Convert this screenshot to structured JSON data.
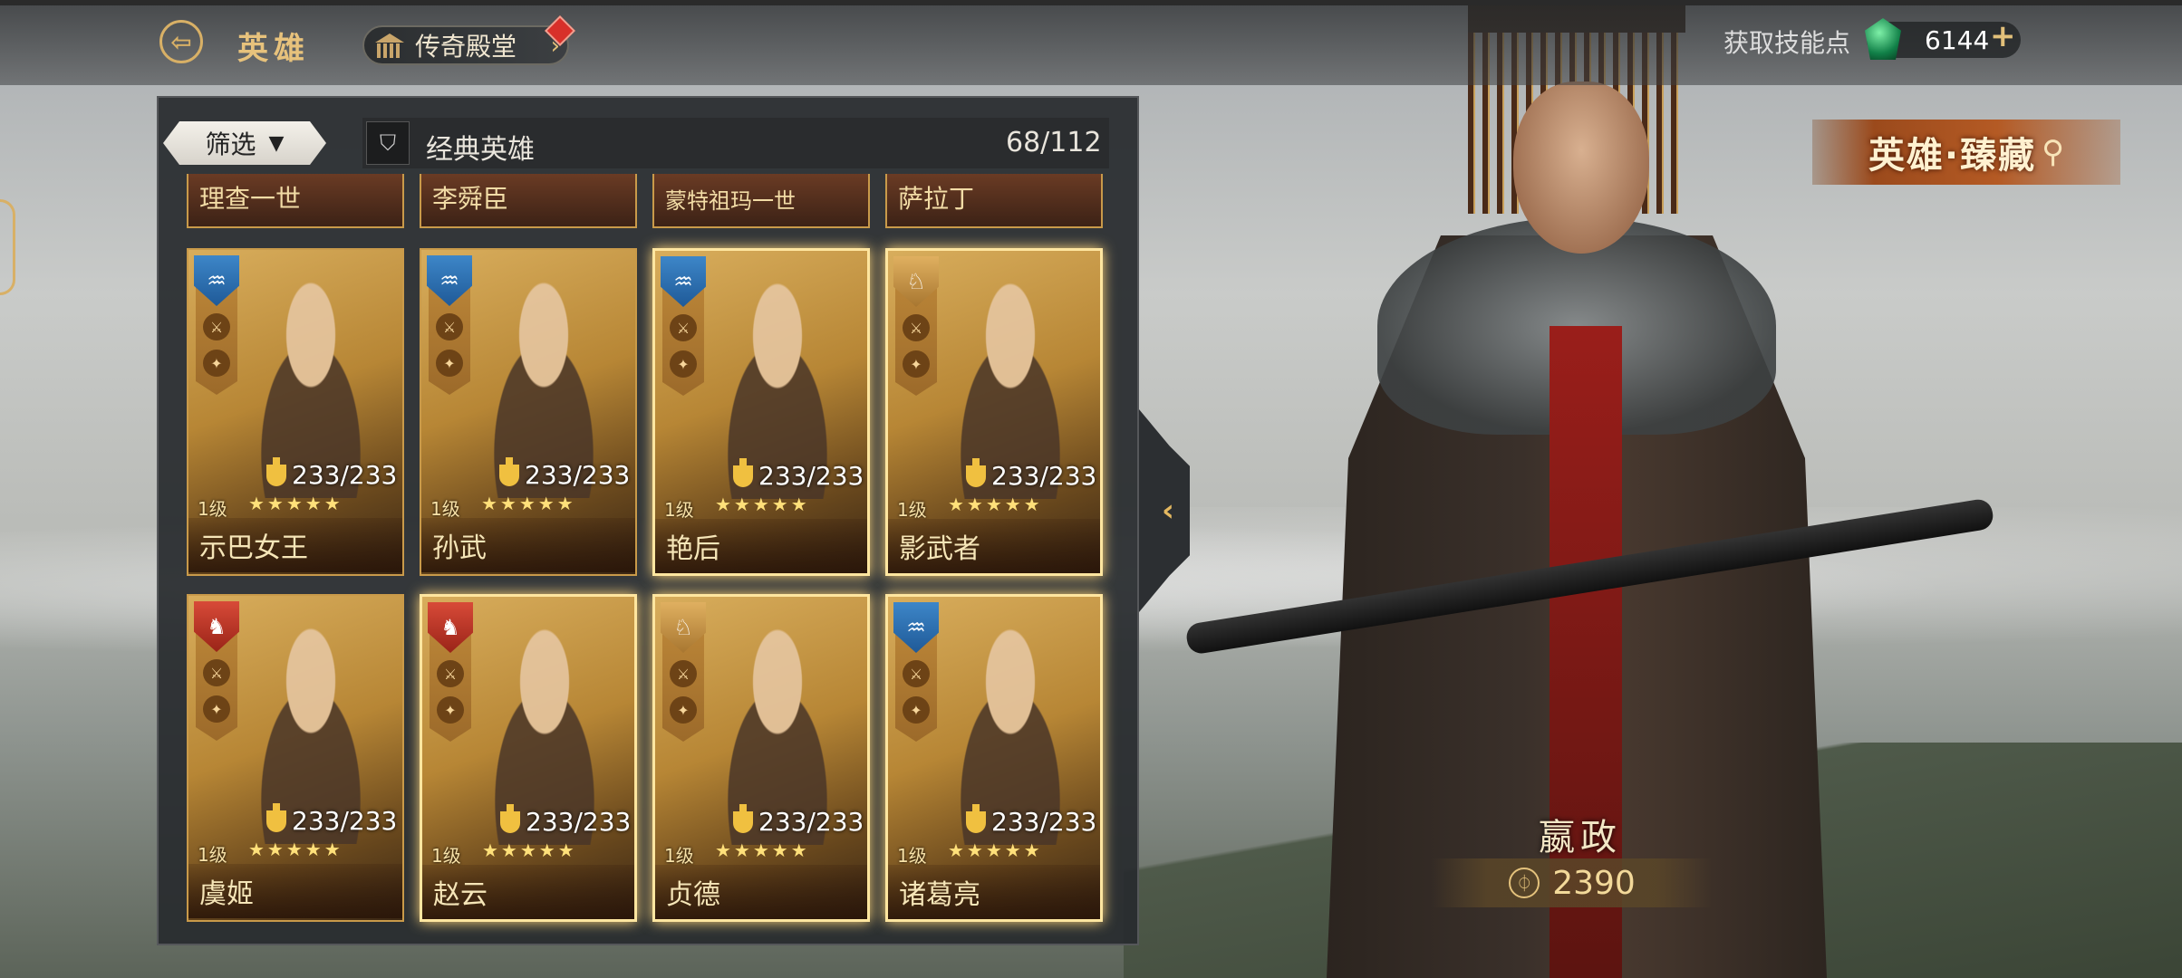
{
  "header": {
    "title": "英雄",
    "hall_label": "传奇殿堂",
    "skill_points_label": "获取技能点",
    "skill_points_value": "6144",
    "plus": "+"
  },
  "collection_badge": {
    "label": "英雄·臻藏"
  },
  "panel": {
    "filter_label": "筛选",
    "series_label": "经典英雄",
    "count": "68/112",
    "partial_row": [
      "理查一世",
      "李舜臣",
      "蒙特祖玛一世",
      "萨拉丁"
    ],
    "cards": [
      {
        "name": "示巴女王",
        "shield": "blue",
        "potion": "233/233",
        "level": "1级",
        "stars": "★★★★★",
        "glow": false
      },
      {
        "name": "孙武",
        "shield": "blue",
        "potion": "233/233",
        "level": "1级",
        "stars": "★★★★★",
        "glow": false
      },
      {
        "name": "艳后",
        "shield": "blue",
        "potion": "233/233",
        "level": "1级",
        "stars": "★★★★★",
        "glow": true
      },
      {
        "name": "影武者",
        "shield": "gold",
        "potion": "233/233",
        "level": "1级",
        "stars": "★★★★★",
        "glow": true
      },
      {
        "name": "虞姬",
        "shield": "red",
        "potion": "233/233",
        "level": "1级",
        "stars": "★★★★★",
        "glow": false
      },
      {
        "name": "赵云",
        "shield": "red",
        "potion": "233/233",
        "level": "1级",
        "stars": "★★★★★",
        "glow": true
      },
      {
        "name": "贞德",
        "shield": "gold",
        "potion": "233/233",
        "level": "1级",
        "stars": "★★★★★",
        "glow": true
      },
      {
        "name": "诸葛亮",
        "shield": "blue",
        "potion": "233/233",
        "level": "1级",
        "stars": "★★★★★",
        "glow": true
      }
    ]
  },
  "featured_hero": {
    "name": "嬴政",
    "power": "2390"
  },
  "colors": {
    "accent_gold": "#d8b066",
    "panel_bg": "#2a2c2e",
    "red_badge": "#d8302a"
  }
}
